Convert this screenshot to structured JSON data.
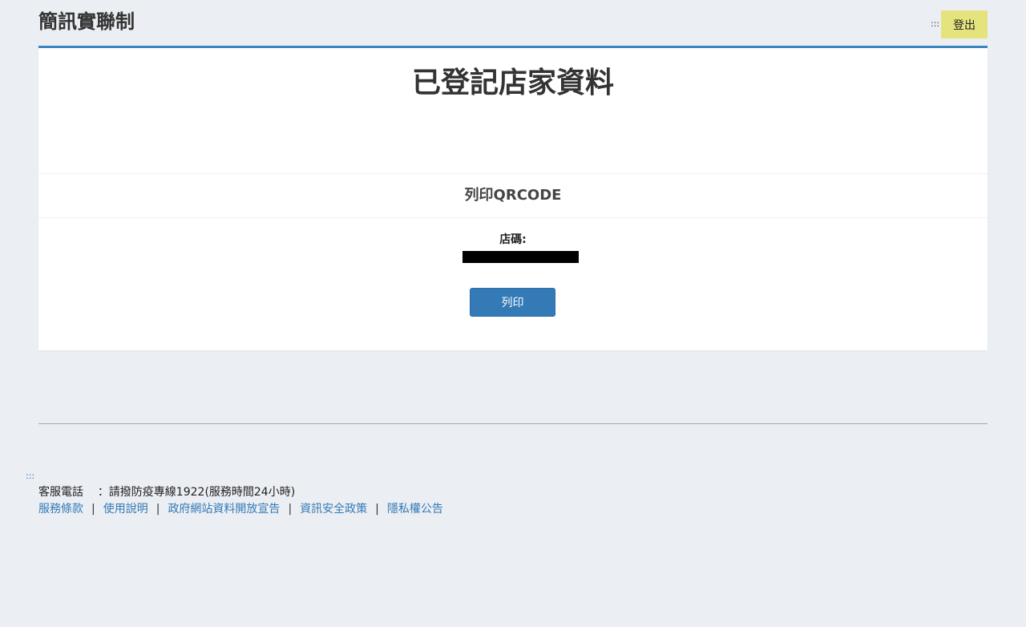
{
  "header": {
    "site_title": "簡訊實聯制",
    "accesskey": ":::",
    "logout_label": "登出"
  },
  "main": {
    "title": "已登記店家資料",
    "section_title": "列印QRCODE",
    "store_code_label": "店碼:",
    "print_label": "列印"
  },
  "footer": {
    "accesskey": ":::",
    "phone_label": "客服電話",
    "phone_value": "：請撥防疫專線1922(服務時間24小時)",
    "links": [
      "服務條款",
      "使用說明",
      "政府網站資料開放宣告",
      "資訊安全政策",
      "隱私權公告"
    ],
    "link_separator": "|"
  },
  "colors": {
    "page_background": "#ebeef3",
    "accent": "#3b86c2",
    "button_primary": "#337ab7",
    "logout_button": "#e4e37d",
    "link": "#337ab7"
  }
}
